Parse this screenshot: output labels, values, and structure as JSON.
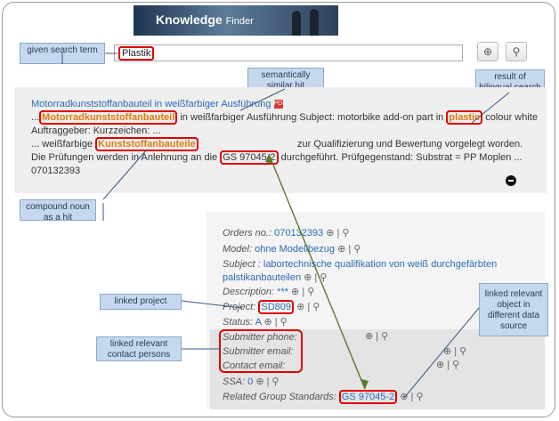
{
  "banner": {
    "title": "Knowledge",
    "subtitle": "Finder"
  },
  "search": {
    "value": "Plastik",
    "zoom_icon": "zoom-in-icon",
    "search_icon": "search-icon"
  },
  "labels": {
    "given_search_term": "given search term",
    "semantically_similar": "semantically similar hit",
    "bilingual": "result of bilingual search",
    "compound_noun": "compound noun as a hit",
    "linked_project": "linked project",
    "linked_contacts": "linked relevant contact persons",
    "linked_object": "linked relevant object in different data source"
  },
  "hit": {
    "title": "Motorradkunststoffanbauteil in weißfarbiger Ausführung",
    "l2_hl": "Motorradkunststoffanbauteil",
    "l2_a": " in weißfarbiger Ausführung Subject: motorbike add-on part in ",
    "l2_hl2": "plastic",
    "l2_b": " colour white",
    "l3": "Auftraggeber: Kurzzeichen: ...",
    "l4_a": "... weißfarbige ",
    "l4_hl": "Kunststoffanbauteile",
    "l4_b": "zur Qualifizierung und Bewertung vorgelegt worden.",
    "l5_a": "Die Prüfungen werden in Anlehnung an die ",
    "l5_box": "GS 97045-2",
    "l5_b": " durchgeführt. Prüfgegenstand: Substrat = PP Moplen ...",
    "l6": "070132393"
  },
  "details": {
    "orders_label": "Orders no.:",
    "orders_value": "070132393",
    "model_label": "Model:",
    "model_value": "ohne Modellbezug",
    "subject_label": "Subject :",
    "subject_value1": "labortechnische qualifikation von weiß durchgefärbten",
    "subject_value2": "palstikanbauteilen",
    "description_label": "Description:",
    "description_value": "***",
    "project_label": "Project:",
    "project_value": "SD809",
    "status_label": "Status:",
    "status_value": "A",
    "phone_label": "Submitter phone:",
    "email_label": "Submitter email:",
    "contact_label": "Contact email:",
    "ssa_label": "SSA:",
    "ssa_value": "0",
    "group_label": "Related Group Standards:",
    "group_value": "GS 97045-2"
  },
  "magnifier": "⊕ | ⚲",
  "colors": {
    "label_bg": "#c5d8ee",
    "highlight": "#e07a10",
    "box": "#e00000",
    "link": "#2d6bb5"
  }
}
